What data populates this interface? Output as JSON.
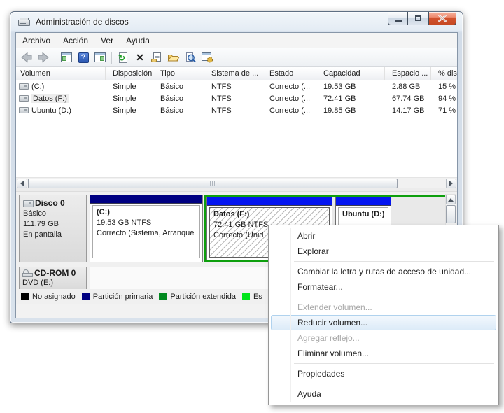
{
  "window": {
    "title": "Administración de discos"
  },
  "menubar": {
    "items": [
      "Archivo",
      "Acción",
      "Ver",
      "Ayuda"
    ]
  },
  "toolbar": {
    "icon_names": [
      "back",
      "forward",
      "show-console-tree",
      "help",
      "show-action-pane",
      "refresh",
      "delete",
      "properties",
      "open-folder",
      "search",
      "new-window"
    ],
    "glyphs": {
      "help": "?",
      "refresh": "↻",
      "delete": "✕"
    }
  },
  "volume_list": {
    "columns": [
      "Volumen",
      "Disposición",
      "Tipo",
      "Sistema de ...",
      "Estado",
      "Capacidad",
      "Espacio ...",
      "% disp"
    ],
    "rows": [
      {
        "name": "(C:)",
        "layout": "Simple",
        "type": "Básico",
        "fs": "NTFS",
        "status": "Correcto (...",
        "capacity": "19.53 GB",
        "free": "2.88 GB",
        "pct_free": "15 %"
      },
      {
        "name": "Datos (F:)",
        "layout": "Simple",
        "type": "Básico",
        "fs": "NTFS",
        "status": "Correcto (...",
        "capacity": "72.41 GB",
        "free": "67.74 GB",
        "pct_free": "94 %"
      },
      {
        "name": "Ubuntu (D:)",
        "layout": "Simple",
        "type": "Básico",
        "fs": "NTFS",
        "status": "Correcto (...",
        "capacity": "19.85 GB",
        "free": "14.17 GB",
        "pct_free": "71 %"
      }
    ]
  },
  "disk_view": {
    "disk0": {
      "name": "Disco 0",
      "type": "Básico",
      "size": "111.79 GB",
      "status": "En pantalla",
      "partitions": {
        "c": {
          "label": "(C:)",
          "size": "19.53 GB NTFS",
          "status": "Correcto (Sistema, Arranque"
        },
        "datos": {
          "label": "Datos  (F:)",
          "size": "72.41 GB NTFS",
          "status": "Correcto (Unid"
        },
        "ubuntu": {
          "label": "Ubuntu  (D:)"
        }
      }
    },
    "cdrom": {
      "name": "CD-ROM 0",
      "media": "DVD (E:)"
    }
  },
  "legend": {
    "items": [
      {
        "label": "No asignado",
        "color": "#000000"
      },
      {
        "label": "Partición primaria",
        "color": "#000082"
      },
      {
        "label": "Partición extendida",
        "color": "#00891f"
      },
      {
        "label": "Es",
        "color": "#00e51a"
      }
    ]
  },
  "colors": {
    "primary_partition": "#000082",
    "logical_drive": "#0415f0",
    "extended_border": "#0d9f0d"
  },
  "context_menu": {
    "items": [
      {
        "label": "Abrir",
        "state": "normal"
      },
      {
        "label": "Explorar",
        "state": "normal"
      },
      {
        "label": "Cambiar la letra y rutas de acceso de unidad...",
        "state": "normal"
      },
      {
        "label": "Formatear...",
        "state": "normal"
      },
      {
        "label": "Extender volumen...",
        "state": "disabled"
      },
      {
        "label": "Reducir volumen...",
        "state": "highlighted"
      },
      {
        "label": "Agregar reflejo...",
        "state": "disabled"
      },
      {
        "label": "Eliminar volumen...",
        "state": "normal"
      },
      {
        "label": "Propiedades",
        "state": "normal"
      },
      {
        "label": "Ayuda",
        "state": "normal"
      }
    ]
  }
}
